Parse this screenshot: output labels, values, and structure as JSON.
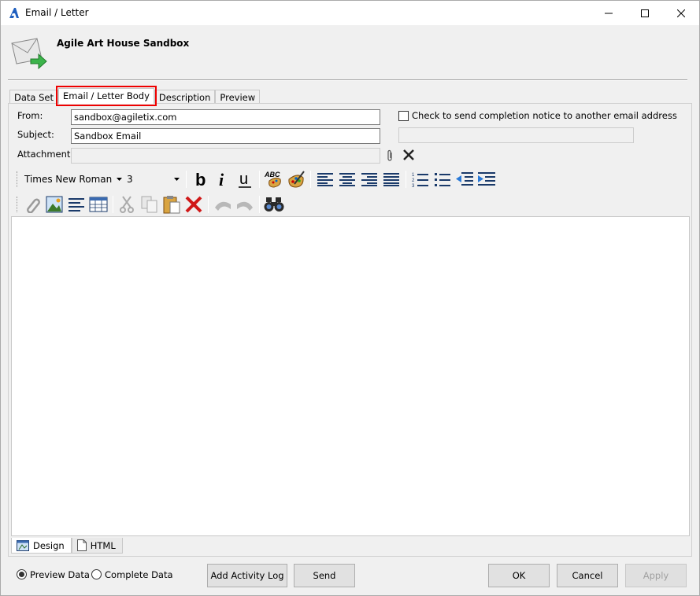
{
  "window": {
    "title": "Email / Letter"
  },
  "header": {
    "title": "Agile Art House Sandbox"
  },
  "tabs": [
    {
      "label": "Data Set"
    },
    {
      "label": "Email / Letter Body"
    },
    {
      "label": "Description"
    },
    {
      "label": "Preview"
    }
  ],
  "form": {
    "from_label": "From:",
    "from_value": "sandbox@agiletix.com",
    "subject_label": "Subject:",
    "subject_value": "Sandbox Email",
    "attachment_label": "Attachment:",
    "attachment_value": "",
    "notice_label": "Check to send completion notice to another email address",
    "notice_checked": false
  },
  "toolbar": {
    "font": "Times New Roman",
    "size": "3"
  },
  "editor_tabs": [
    {
      "label": "Design"
    },
    {
      "label": "HTML"
    }
  ],
  "footer": {
    "radio_preview": "Preview Data",
    "radio_complete": "Complete Data",
    "add_log": "Add Activity Log",
    "send": "Send",
    "ok": "OK",
    "cancel": "Cancel",
    "apply": "Apply"
  },
  "colors": {
    "accent": "#e00000",
    "titlebar": "#ffffff",
    "app_icon": "#1f5fbf"
  }
}
